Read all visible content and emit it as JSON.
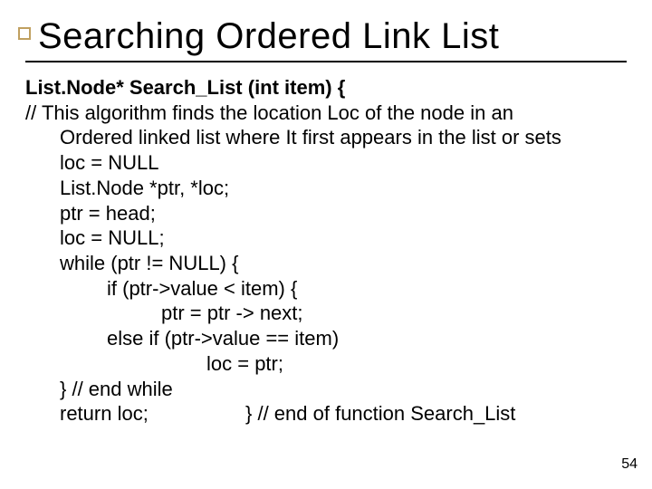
{
  "title": "Searching  Ordered Link List",
  "body": {
    "sig": "List.Node* Search_List (int  item) {",
    "comment1": "// This algorithm finds the location Loc of the node in an",
    "comment2": "Ordered linked list where It first appears in the list or sets",
    "comment3": "loc = NULL",
    "decl": "List.Node  *ptr, *loc;",
    "ptr_init": "ptr = head;",
    "loc_init": "loc = NULL;",
    "while_open": " while (ptr != NULL) {",
    "if_cond": "if (ptr->value < item) {",
    "ptr_next": "ptr = ptr -> next;",
    "elseif": "else if (ptr->value  == item)",
    "loc_assign": "loc = ptr;",
    "end_while": "} // end while",
    "return": "return loc;",
    "end_fn": "} // end of function Search_List"
  },
  "page_number": "54"
}
